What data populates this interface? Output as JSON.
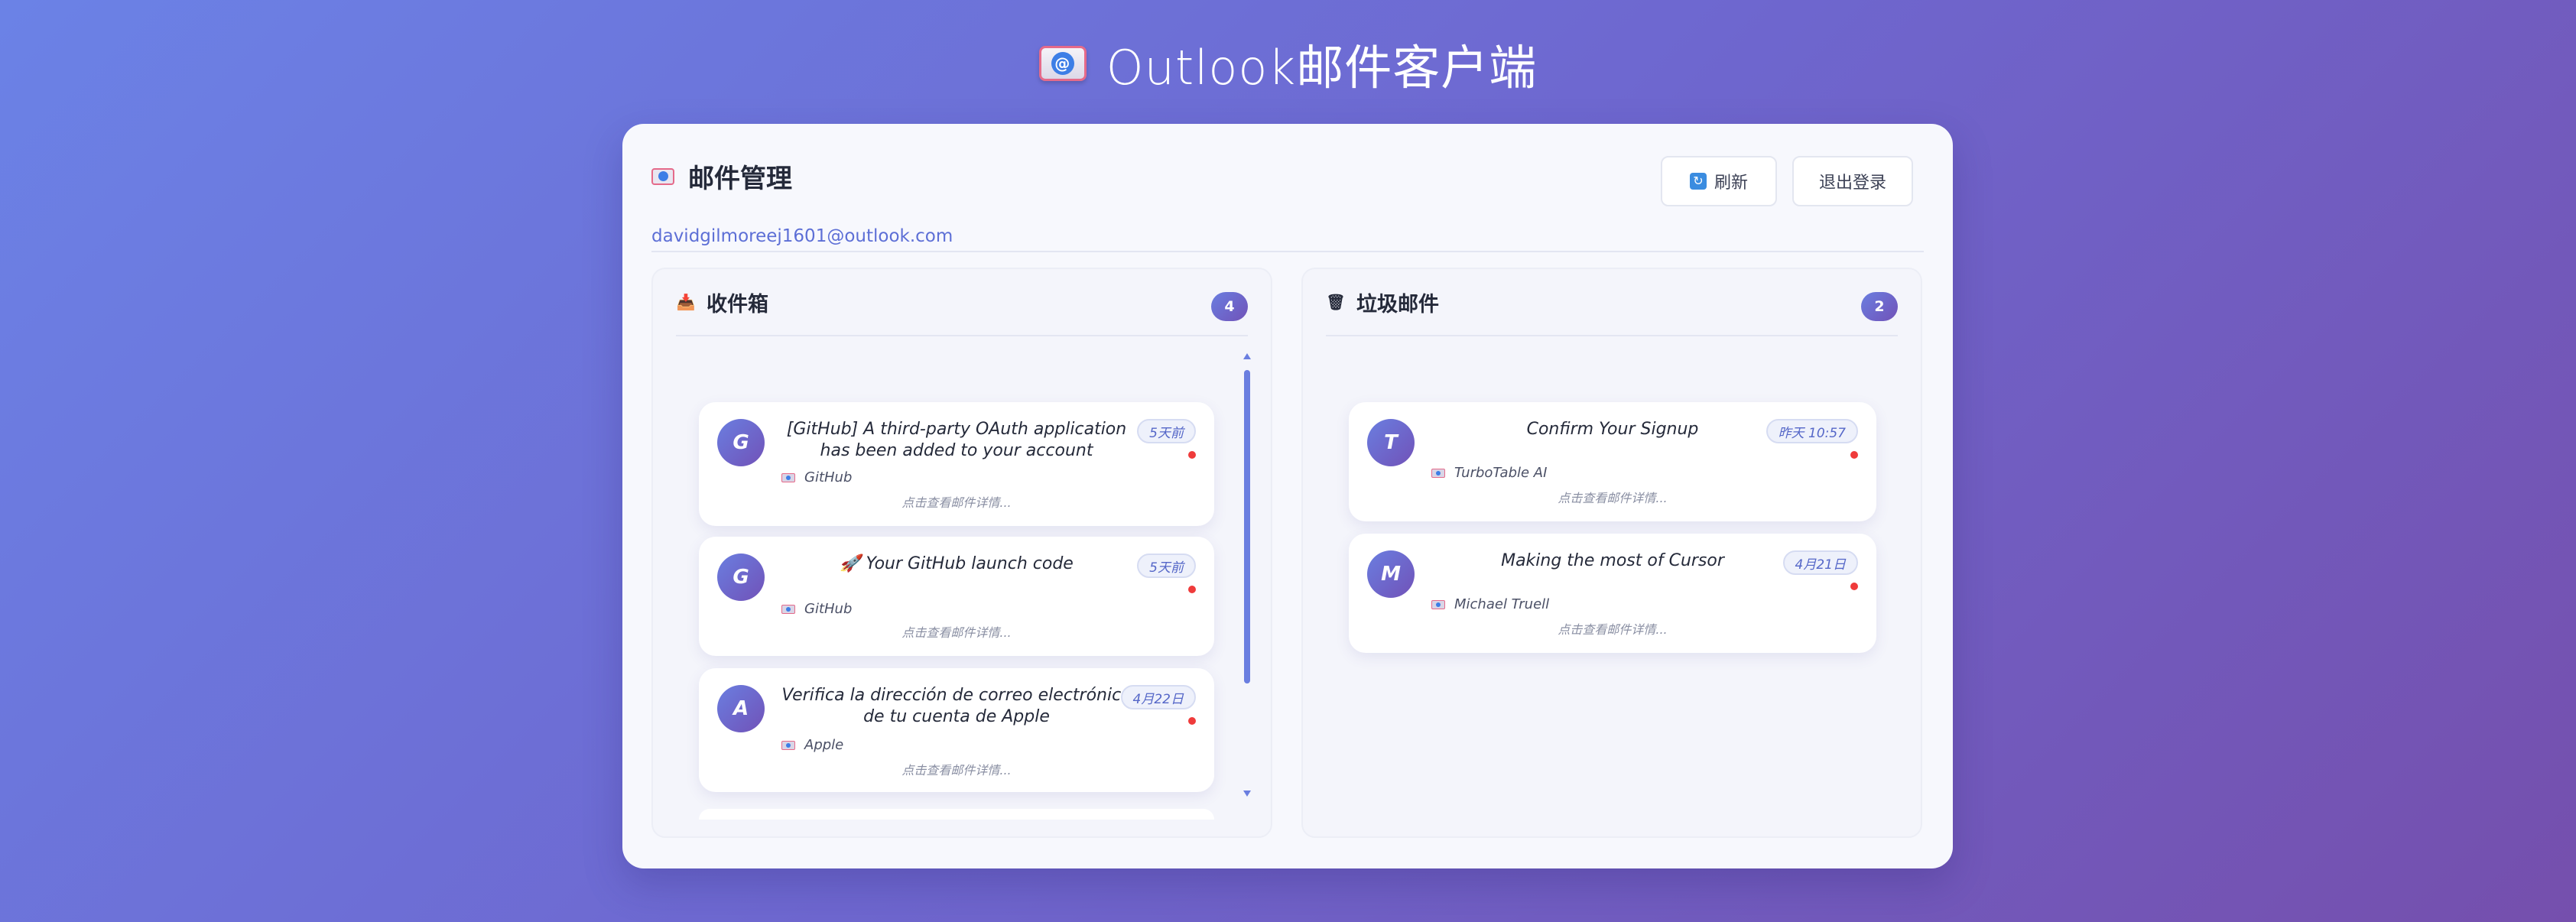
{
  "app": {
    "title": "Outlook邮件客户端",
    "title_icon": "envelope-at-icon"
  },
  "header": {
    "title": "邮件管理",
    "email": "davidgilmoreej1601@outlook.com",
    "refresh_label": "刷新",
    "logout_label": "退出登录"
  },
  "inbox": {
    "title": "收件箱",
    "count": "4",
    "items": [
      {
        "avatar": "G",
        "subject": "[GitHub] A third-party OAuth application has been added to your account",
        "time": "5天前",
        "sender": "GitHub",
        "hint": "点击查看邮件详情...",
        "unread": true
      },
      {
        "avatar": "G",
        "subject": "🚀 Your GitHub launch code",
        "time": "5天前",
        "sender": "GitHub",
        "hint": "点击查看邮件详情...",
        "unread": true
      },
      {
        "avatar": "A",
        "subject": "Verifica la dirección de correo electrónico de tu cuenta de Apple",
        "time": "4月22日",
        "sender": "Apple",
        "hint": "点击查看邮件详情...",
        "unread": true
      }
    ]
  },
  "junk": {
    "title": "垃圾邮件",
    "count": "2",
    "items": [
      {
        "avatar": "T",
        "subject": "Confirm Your Signup",
        "time": "昨天 10:57",
        "sender": "TurboTable AI",
        "hint": "点击查看邮件详情...",
        "unread": true
      },
      {
        "avatar": "M",
        "subject": "Making the most of Cursor",
        "time": "4月21日",
        "sender": "Michael Truell",
        "hint": "点击查看邮件详情...",
        "unread": true
      }
    ]
  },
  "colors": {
    "accent": "#6a7ee0",
    "accent2": "#7152b8",
    "unread": "#ef3b3b"
  }
}
